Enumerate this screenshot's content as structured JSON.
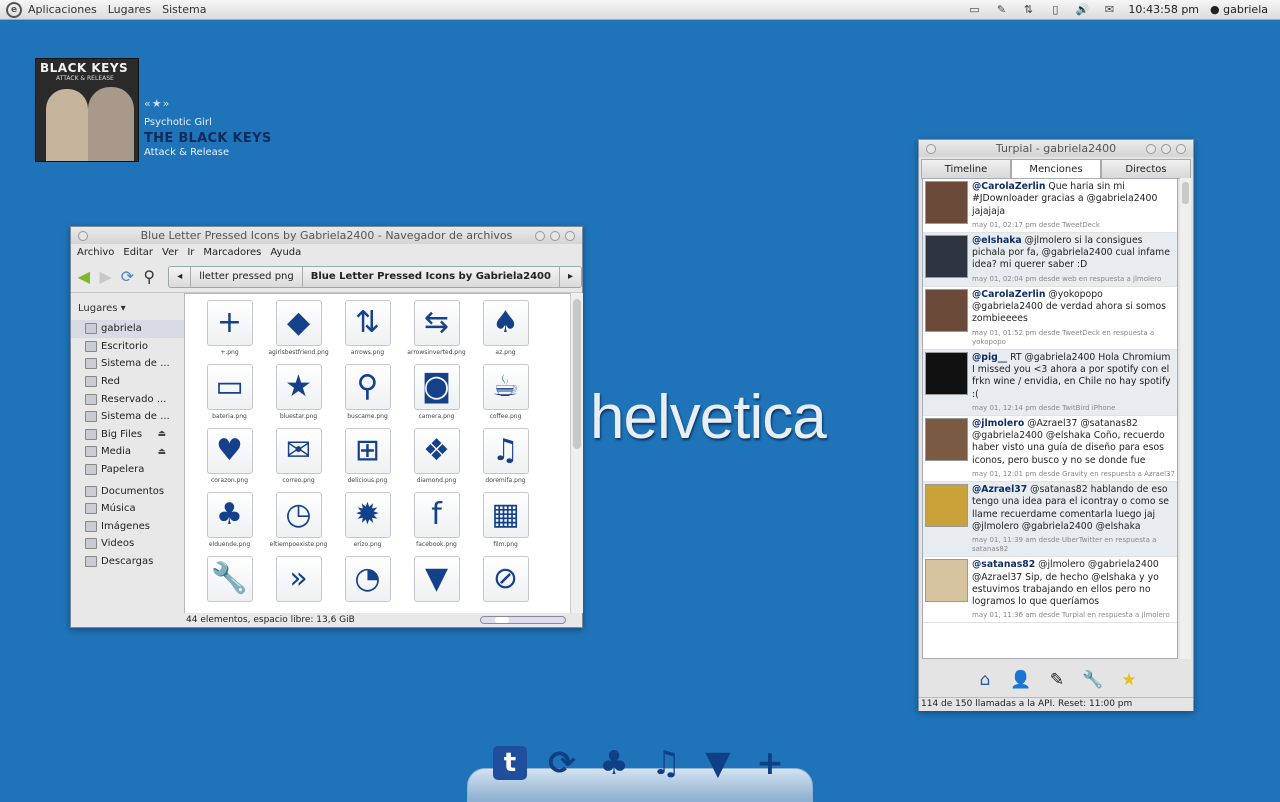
{
  "top_panel": {
    "menus": [
      "Aplicaciones",
      "Lugares",
      "Sistema"
    ],
    "tray_icons": [
      "monitor-icon",
      "turpial-icon",
      "network-icon",
      "battery-icon",
      "volume-icon",
      "mail-icon"
    ],
    "clock": "10:43:58 pm",
    "user": "gabriela"
  },
  "now_playing": {
    "cover_band": "BLACK KEYS",
    "cover_album": "ATTACK & RELEASE",
    "song": "Psychotic Girl",
    "artist": "THE BLACK KEYS",
    "album": "Attack & Release"
  },
  "desktop_text": "helvetica",
  "file_manager": {
    "title": "Blue Letter Pressed Icons by Gabriela2400 - Navegador de archivos",
    "menus": [
      "Archivo",
      "Editar",
      "Ver",
      "Ir",
      "Marcadores",
      "Ayuda"
    ],
    "path": [
      "lletter pressed png",
      "Blue Letter Pressed Icons by Gabriela2400"
    ],
    "sidebar_header": "Lugares",
    "places": [
      {
        "label": "gabriela",
        "eject": ""
      },
      {
        "label": "Escritorio",
        "eject": ""
      },
      {
        "label": "Sistema de ...",
        "eject": ""
      },
      {
        "label": "Red",
        "eject": ""
      },
      {
        "label": "Reservado ...",
        "eject": ""
      },
      {
        "label": "Sistema de ...",
        "eject": ""
      },
      {
        "label": "Big Files",
        "eject": "⏏"
      },
      {
        "label": "Media",
        "eject": "⏏"
      },
      {
        "label": "Papelera",
        "eject": ""
      }
    ],
    "bookmarks": [
      "Documentos",
      "Música",
      "Imágenes",
      "Videos",
      "Descargas"
    ],
    "files": [
      {
        "name": "+.png",
        "glyph": "+"
      },
      {
        "name": "agirlsbestfriend.png",
        "glyph": "◆"
      },
      {
        "name": "arrows.png",
        "glyph": "⇅"
      },
      {
        "name": "arrowsinverted.png",
        "glyph": "⇆"
      },
      {
        "name": "az.png",
        "glyph": "♠"
      },
      {
        "name": "bateria.png",
        "glyph": "▭"
      },
      {
        "name": "bluestar.png",
        "glyph": "★"
      },
      {
        "name": "buscame.png",
        "glyph": "⚲"
      },
      {
        "name": "camera.png",
        "glyph": "◙"
      },
      {
        "name": "coffee.png",
        "glyph": "☕"
      },
      {
        "name": "corazon.png",
        "glyph": "♥"
      },
      {
        "name": "correo.png",
        "glyph": "✉"
      },
      {
        "name": "delicious.png",
        "glyph": "⊞"
      },
      {
        "name": "diamond.png",
        "glyph": "❖"
      },
      {
        "name": "doremifa.png",
        "glyph": "♫"
      },
      {
        "name": "elduende.png",
        "glyph": "♣"
      },
      {
        "name": "eltiempoexiste.png",
        "glyph": "◷"
      },
      {
        "name": "erizo.png",
        "glyph": "✹"
      },
      {
        "name": "facebook.png",
        "glyph": "f"
      },
      {
        "name": "film.png",
        "glyph": "▦"
      },
      {
        "name": "",
        "glyph": "🔧"
      },
      {
        "name": "",
        "glyph": "»"
      },
      {
        "name": "",
        "glyph": "◔"
      },
      {
        "name": "",
        "glyph": "▼"
      },
      {
        "name": "",
        "glyph": "⊘"
      }
    ],
    "status": "44 elementos, espacio libre: 13,6 GiB"
  },
  "turpial": {
    "title": "Turpial - gabriela2400",
    "tabs": [
      "Timeline",
      "Menciones",
      "Directos"
    ],
    "active_tab": "Menciones",
    "tweets": [
      {
        "user": "@CarolaZerlin",
        "text": "Que haria sin mi #JDownloader gracias a @gabriela2400 jajajaja",
        "meta": "may 01, 02:17 pm desde TweetDeck",
        "avatar_color": "#6b4a3a"
      },
      {
        "user": "@elshaka",
        "text": "@jlmolero si la consigues pichala por fa, @gabriela2400 cual infame idea? mi querer saber :D",
        "meta": "may 01, 02:04 pm desde web en respuesta a jlmolero",
        "avatar_color": "#2d3440"
      },
      {
        "user": "@CarolaZerlin",
        "text": "@yokopopo @gabriela2400 de verdad ahora si somos zombieeees",
        "meta": "may 01, 01:52 pm desde TweetDeck en respuesta a yokopopo",
        "avatar_color": "#6b4a3a"
      },
      {
        "user": "@pig__",
        "text": "RT @gabriela2400 Hola Chromium I missed you <3 ahora a por spotify con el frkn wine / envidia, en Chile no hay spotify :(",
        "meta": "may 01, 12:14 pm desde TwitBird iPhone",
        "avatar_color": "#111111"
      },
      {
        "user": "@jlmolero",
        "text": "@Azrael37 @satanas82 @gabriela2400 @elshaka Coño, recuerdo haber visto una guía de diseño para esos iconos, pero busco y no se donde fue",
        "meta": "may 01, 12:01 pm desde Gravity en respuesta a Azrael37",
        "avatar_color": "#7a5a40"
      },
      {
        "user": "@Azrael37",
        "text": "@satanas82 hablando de eso tengo una idea para el icontray o como se llame recuerdame comentarla luego jaj @jlmolero @gabriela2400 @elshaka",
        "meta": "may 01, 11:39 am desde UberTwitter en respuesta a satanas82",
        "avatar_color": "#c9a23a"
      },
      {
        "user": "@satanas82",
        "text": "@jlmolero @gabriela2400 @Azrael37 Sip, de hecho @elshaka y yo estuvimos trabajando en ellos pero no logramos lo que queríamos",
        "meta": "may 01, 11:36 am desde Turpial en respuesta a jlmolero",
        "avatar_color": "#d8c3a0"
      }
    ],
    "bottom_icons": [
      "⌂",
      "👤",
      "✎",
      "🔧",
      "★"
    ],
    "status": "114 de 150 llamadas a la API. Reset: 11:00 pm"
  },
  "dock": {
    "icons": [
      {
        "name": "twitter-icon",
        "glyph": "t"
      },
      {
        "name": "refresh-icon",
        "glyph": "⟳"
      },
      {
        "name": "club-icon",
        "glyph": "♣"
      },
      {
        "name": "music-note-icon",
        "glyph": "♫"
      },
      {
        "name": "speech-bubble-icon",
        "glyph": "▼"
      },
      {
        "name": "plus-icon",
        "glyph": "+"
      }
    ]
  }
}
